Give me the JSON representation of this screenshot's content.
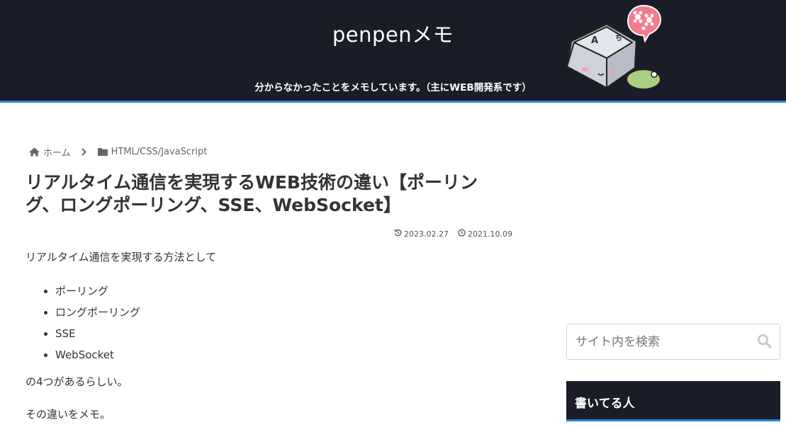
{
  "header": {
    "site_title": "penpenメモ",
    "description": "分からなかったことをメモしています。（主にWEB開発系です）",
    "mascot_key_left": "A",
    "mascot_key_right": "ち"
  },
  "breadcrumb": {
    "home_label": "ホーム",
    "category_label": "HTML/CSS/JavaScript"
  },
  "article": {
    "title": "リアルタイム通信を実現するWEB技術の違い【ポーリング、ロングポーリング、SSE、WebSocket】",
    "updated_date": "2023.02.27",
    "published_date": "2021.10.09",
    "intro": "リアルタイム通信を実現する方法として",
    "list_items": [
      "ポーリング",
      "ロングポーリング",
      "SSE",
      "WebSocket"
    ],
    "after_list": "の4つがあるらしい。",
    "memo": "その違いをメモ。"
  },
  "sidebar": {
    "search_placeholder": "サイト内を検索",
    "widget_title": "書いてる人"
  },
  "colors": {
    "header_bg": "#1a1c27",
    "accent": "#2b8ad8"
  },
  "icons": [
    "home-icon",
    "chevron-right-icon",
    "folder-icon",
    "update-icon",
    "clock-icon",
    "search-icon"
  ]
}
